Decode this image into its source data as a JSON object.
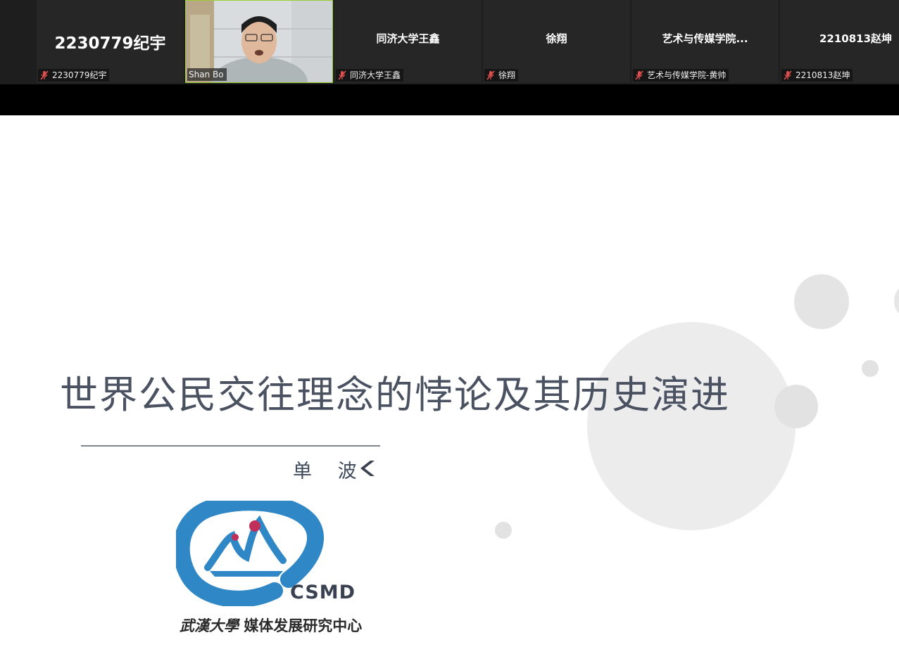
{
  "participants": [
    {
      "display_name": "2230779纪宇",
      "tag": "2230779纪宇"
    },
    {
      "display_name": "",
      "tag": "Shan Bo",
      "video": true
    },
    {
      "display_name": "同济大学王鑫",
      "tag": "同济大学王鑫"
    },
    {
      "display_name": "徐翔",
      "tag": "徐翔"
    },
    {
      "display_name": "艺术与传媒学院...",
      "tag": "艺术与传媒学院-黄帅"
    },
    {
      "display_name": "2210813赵坤",
      "tag": "2210813赵坤"
    }
  ],
  "slide": {
    "title": "世界公民交往理念的悖论及其历史演进",
    "author": "单 波",
    "logo_text": "CSMD",
    "org_script": "武漢大學",
    "org_name": "媒体发展研究中心"
  },
  "colors": {
    "logo_blue": "#2f87c6",
    "logo_red": "#c0305a",
    "title": "#4a5160",
    "muted_mic": "#e05050"
  },
  "icons": {
    "muted": "mic-muted-icon",
    "author_marker": "chevron-left-icon"
  }
}
